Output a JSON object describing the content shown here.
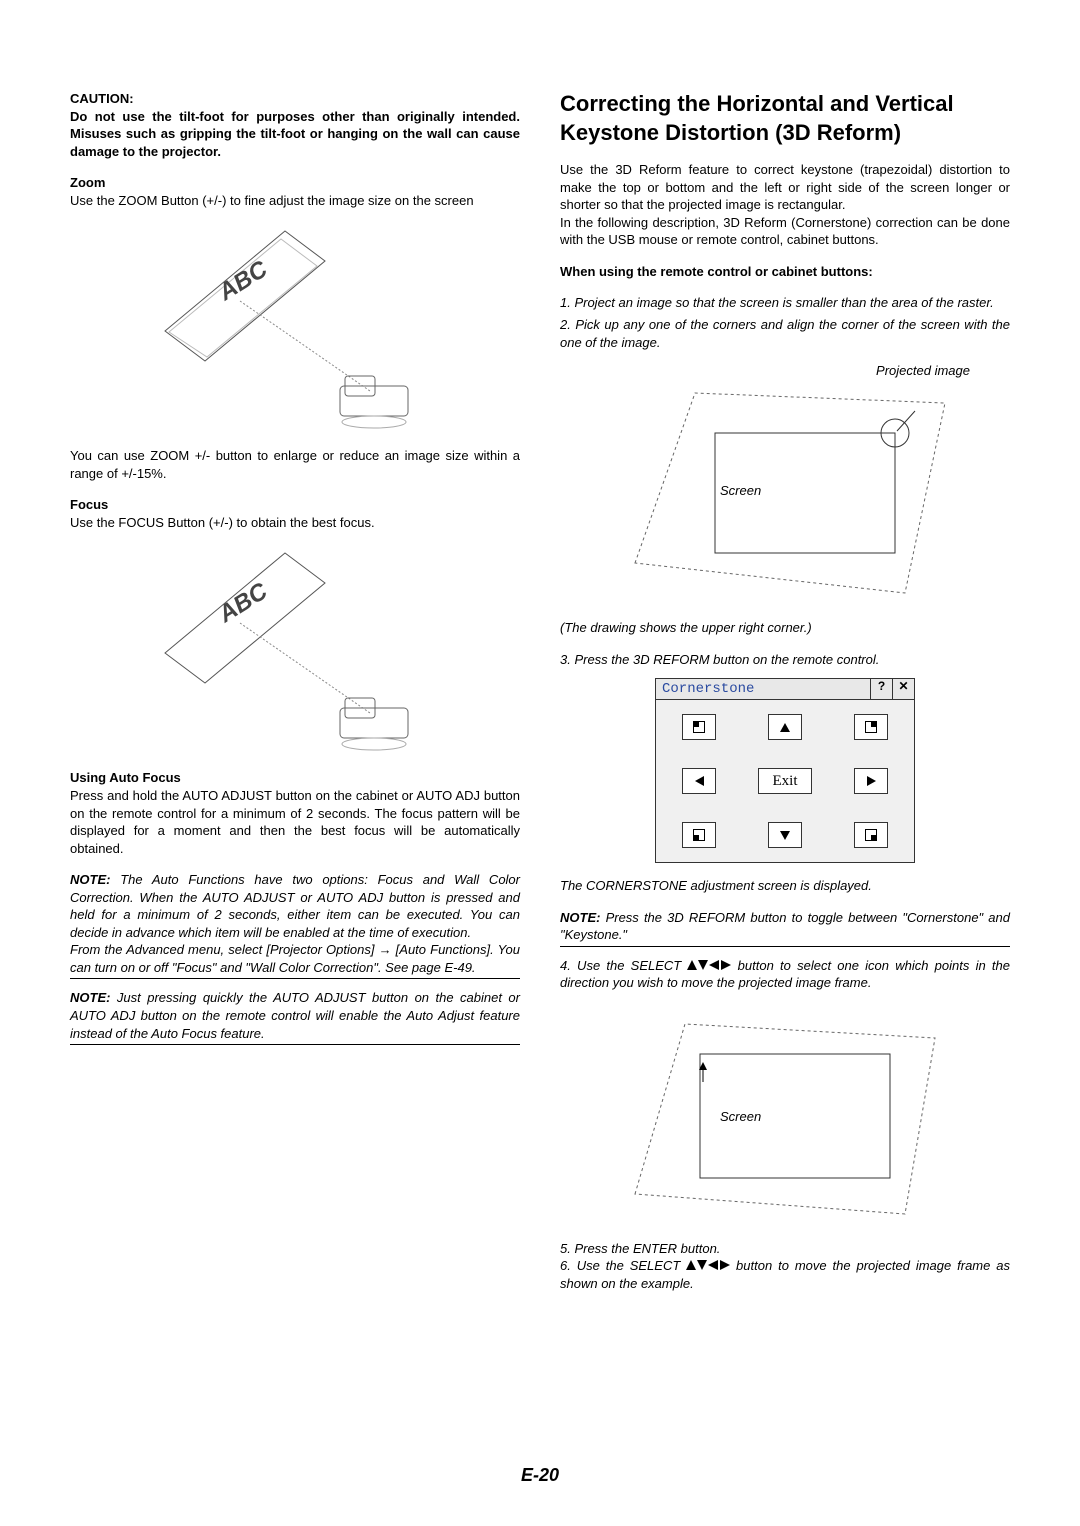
{
  "left": {
    "caution_label": "CAUTION:",
    "caution_text": "Do not use the tilt-foot for purposes other than originally intended. Misuses such as gripping the tilt-foot or hanging on the wall can cause damage to the projector.",
    "zoom_label": "Zoom",
    "zoom_text": "Use the ZOOM Button (+/-) to fine adjust the image size on the screen",
    "zoom_caption": "You can use ZOOM +/- button to enlarge or reduce an image size within a range of +/-15%.",
    "focus_label": "Focus",
    "focus_text": "Use the FOCUS Button (+/-) to obtain the best focus.",
    "auto_focus_label": "Using Auto Focus",
    "auto_focus_text": "Press and hold the AUTO ADJUST button on the cabinet or AUTO ADJ button on the remote control for a minimum of 2 seconds. The focus pattern will be displayed for a moment and then the best focus will be automatically obtained.",
    "note1_label": "NOTE:",
    "note1_text_a": " The Auto Functions have two options: Focus and Wall Color Correction. When the AUTO ADJUST or AUTO ADJ button is pressed and held for a minimum of 2 seconds, either item can be executed. You can decide in advance which item will be enabled at the time of execution.",
    "note1_text_b": "From the Advanced menu, select [Projector Options] → [Auto Functions]. You can turn on or off \"Focus\" and \"Wall Color Correction\". See page E-49.",
    "note2_label": "NOTE:",
    "note2_text": " Just pressing quickly the AUTO ADJUST button on the cabinet or AUTO ADJ button on the remote control will enable the Auto Adjust feature instead of the Auto Focus feature.",
    "abc": "ABC"
  },
  "right": {
    "heading": "Correcting the Horizontal and Vertical Keystone Distortion (3D Reform)",
    "intro_a": "Use the 3D Reform feature to correct keystone (trapezoidal) distortion to make the top or bottom and the left or right side of the screen longer or shorter so that the projected image is rectangular.",
    "intro_b": "In the following description, 3D Reform (Cornerstone) correction can be done with the USB mouse or remote control, cabinet buttons.",
    "when_using_label": "When using the remote control or cabinet buttons:",
    "step1": "1. Project an image so that the screen is smaller than the area of the raster.",
    "step2": "2. Pick up any one of the corners and align the corner of the screen with the one of the image.",
    "projected_label": "Projected image",
    "screen_label": "Screen",
    "drawing_caption": "(The drawing shows the upper right corner.)",
    "step3": "3. Press the 3D REFORM button on the remote control.",
    "cornerstone_title": "Cornerstone",
    "exit_label": "Exit",
    "help_symbol": "?",
    "close_symbol": "✕",
    "cornerstone_caption": "The CORNERSTONE adjustment screen is displayed.",
    "note3_label": "NOTE:",
    "note3_text": " Press the 3D REFORM button to toggle between \"Cornerstone\" and \"Keystone.\"",
    "step4_a": "4. Use the SELECT ",
    "step4_b": " button to select one icon which points in the direction you wish to move the projected image frame.",
    "step5": "5. Press the ENTER button.",
    "step6_a": "6. Use the SELECT ",
    "step6_b": " button to move the projected image frame as shown on the example."
  },
  "page_number": "E-20"
}
